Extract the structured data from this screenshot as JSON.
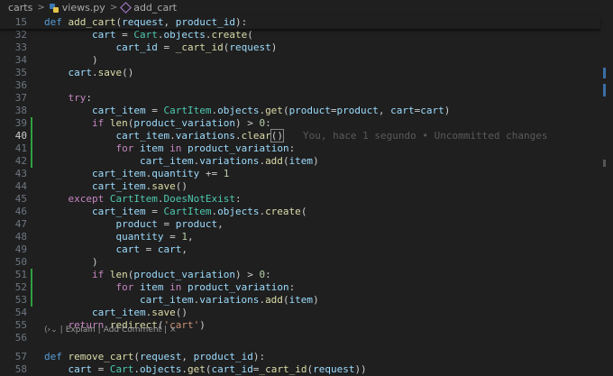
{
  "breadcrumb": {
    "folder": "carts",
    "file": "views.py",
    "symbol": "add_cart"
  },
  "colors": {
    "background": "#1f1f1f",
    "added_line_bar": "#2ea043",
    "scroll_marker": "#3a6ea5"
  },
  "editor": {
    "lines": [
      {
        "num": "15",
        "sticky": true,
        "segs": [
          [
            "def",
            "def "
          ],
          [
            "fn",
            "add_cart"
          ],
          [
            "plain",
            "("
          ],
          [
            "var",
            "request"
          ],
          [
            "plain",
            ", "
          ],
          [
            "var",
            "product_id"
          ],
          [
            "plain",
            "):"
          ]
        ]
      },
      {
        "num": "32",
        "sticky": false,
        "segs": [
          [
            "plain",
            "        "
          ],
          [
            "var",
            "cart"
          ],
          [
            "plain",
            " = "
          ],
          [
            "cls",
            "Cart"
          ],
          [
            "plain",
            "."
          ],
          [
            "var",
            "objects"
          ],
          [
            "plain",
            "."
          ],
          [
            "fn",
            "create"
          ],
          [
            "plain",
            "("
          ]
        ]
      },
      {
        "num": "33",
        "sticky": false,
        "segs": [
          [
            "plain",
            "            "
          ],
          [
            "var",
            "cart_id"
          ],
          [
            "plain",
            " = "
          ],
          [
            "fn",
            "_cart_id"
          ],
          [
            "plain",
            "("
          ],
          [
            "var",
            "request"
          ],
          [
            "plain",
            ")"
          ]
        ]
      },
      {
        "num": "34",
        "sticky": false,
        "segs": [
          [
            "plain",
            "        )"
          ]
        ]
      },
      {
        "num": "35",
        "sticky": false,
        "segs": [
          [
            "plain",
            "    "
          ],
          [
            "var",
            "cart"
          ],
          [
            "plain",
            "."
          ],
          [
            "fn",
            "save"
          ],
          [
            "plain",
            "()"
          ]
        ]
      },
      {
        "num": "36",
        "sticky": false,
        "segs": []
      },
      {
        "num": "37",
        "sticky": false,
        "segs": [
          [
            "plain",
            "    "
          ],
          [
            "kw",
            "try"
          ],
          [
            "plain",
            ":"
          ]
        ]
      },
      {
        "num": "38",
        "sticky": false,
        "segs": [
          [
            "plain",
            "        "
          ],
          [
            "var",
            "cart_item"
          ],
          [
            "plain",
            " = "
          ],
          [
            "cls",
            "CartItem"
          ],
          [
            "plain",
            "."
          ],
          [
            "var",
            "objects"
          ],
          [
            "plain",
            "."
          ],
          [
            "fn",
            "get"
          ],
          [
            "plain",
            "("
          ],
          [
            "var",
            "product"
          ],
          [
            "plain",
            "="
          ],
          [
            "var",
            "product"
          ],
          [
            "plain",
            ", "
          ],
          [
            "var",
            "cart"
          ],
          [
            "plain",
            "="
          ],
          [
            "var",
            "cart"
          ],
          [
            "plain",
            ")"
          ]
        ]
      },
      {
        "num": "39",
        "sticky": false,
        "mod": true,
        "segs": [
          [
            "plain",
            "        "
          ],
          [
            "kw",
            "if"
          ],
          [
            "plain",
            " "
          ],
          [
            "fn",
            "len"
          ],
          [
            "plain",
            "("
          ],
          [
            "var",
            "product_variation"
          ],
          [
            "plain",
            ") > "
          ],
          [
            "num",
            "0"
          ],
          [
            "plain",
            ":"
          ]
        ]
      },
      {
        "num": "40",
        "sticky": false,
        "mod": true,
        "current": true,
        "segs": [
          [
            "plain",
            "            "
          ],
          [
            "var",
            "cart_item"
          ],
          [
            "plain",
            "."
          ],
          [
            "var",
            "variations"
          ],
          [
            "plain",
            "."
          ],
          [
            "fn",
            "clear"
          ],
          [
            "hl",
            "()"
          ]
        ],
        "blame": "You, hace 1 segundo • Uncommitted changes"
      },
      {
        "num": "41",
        "sticky": false,
        "mod": true,
        "segs": [
          [
            "plain",
            "            "
          ],
          [
            "kw",
            "for"
          ],
          [
            "plain",
            " "
          ],
          [
            "var",
            "item"
          ],
          [
            "plain",
            " "
          ],
          [
            "kw",
            "in"
          ],
          [
            "plain",
            " "
          ],
          [
            "var",
            "product_variation"
          ],
          [
            "plain",
            ":"
          ]
        ]
      },
      {
        "num": "42",
        "sticky": false,
        "mod": true,
        "segs": [
          [
            "plain",
            "                "
          ],
          [
            "var",
            "cart_item"
          ],
          [
            "plain",
            "."
          ],
          [
            "var",
            "variations"
          ],
          [
            "plain",
            "."
          ],
          [
            "fn",
            "add"
          ],
          [
            "plain",
            "("
          ],
          [
            "var",
            "item"
          ],
          [
            "plain",
            ")"
          ]
        ]
      },
      {
        "num": "43",
        "sticky": false,
        "segs": [
          [
            "plain",
            "        "
          ],
          [
            "var",
            "cart_item"
          ],
          [
            "plain",
            "."
          ],
          [
            "var",
            "quantity"
          ],
          [
            "plain",
            " += "
          ],
          [
            "num",
            "1"
          ]
        ]
      },
      {
        "num": "44",
        "sticky": false,
        "segs": [
          [
            "plain",
            "        "
          ],
          [
            "var",
            "cart_item"
          ],
          [
            "plain",
            "."
          ],
          [
            "fn",
            "save"
          ],
          [
            "plain",
            "()"
          ]
        ]
      },
      {
        "num": "45",
        "sticky": false,
        "segs": [
          [
            "plain",
            "    "
          ],
          [
            "kw",
            "except"
          ],
          [
            "plain",
            " "
          ],
          [
            "cls",
            "CartItem"
          ],
          [
            "plain",
            "."
          ],
          [
            "cls",
            "DoesNotExist"
          ],
          [
            "plain",
            ":"
          ]
        ]
      },
      {
        "num": "46",
        "sticky": false,
        "segs": [
          [
            "plain",
            "        "
          ],
          [
            "var",
            "cart_item"
          ],
          [
            "plain",
            " = "
          ],
          [
            "cls",
            "CartItem"
          ],
          [
            "plain",
            "."
          ],
          [
            "var",
            "objects"
          ],
          [
            "plain",
            "."
          ],
          [
            "fn",
            "create"
          ],
          [
            "plain",
            "("
          ]
        ]
      },
      {
        "num": "47",
        "sticky": false,
        "segs": [
          [
            "plain",
            "            "
          ],
          [
            "var",
            "product"
          ],
          [
            "plain",
            " = "
          ],
          [
            "var",
            "product"
          ],
          [
            "plain",
            ","
          ]
        ]
      },
      {
        "num": "48",
        "sticky": false,
        "segs": [
          [
            "plain",
            "            "
          ],
          [
            "var",
            "quantity"
          ],
          [
            "plain",
            " = "
          ],
          [
            "num",
            "1"
          ],
          [
            "plain",
            ","
          ]
        ]
      },
      {
        "num": "49",
        "sticky": false,
        "segs": [
          [
            "plain",
            "            "
          ],
          [
            "var",
            "cart"
          ],
          [
            "plain",
            " = "
          ],
          [
            "var",
            "cart"
          ],
          [
            "plain",
            ","
          ]
        ]
      },
      {
        "num": "50",
        "sticky": false,
        "segs": [
          [
            "plain",
            "        )"
          ]
        ]
      },
      {
        "num": "51",
        "sticky": false,
        "mod": true,
        "segs": [
          [
            "plain",
            "        "
          ],
          [
            "kw",
            "if"
          ],
          [
            "plain",
            " "
          ],
          [
            "fn",
            "len"
          ],
          [
            "plain",
            "("
          ],
          [
            "var",
            "product_variation"
          ],
          [
            "plain",
            ") > "
          ],
          [
            "num",
            "0"
          ],
          [
            "plain",
            ":"
          ]
        ]
      },
      {
        "num": "52",
        "sticky": false,
        "mod": true,
        "segs": [
          [
            "plain",
            "            "
          ],
          [
            "kw",
            "for"
          ],
          [
            "plain",
            " "
          ],
          [
            "var",
            "item"
          ],
          [
            "plain",
            " "
          ],
          [
            "kw",
            "in"
          ],
          [
            "plain",
            " "
          ],
          [
            "var",
            "product_variation"
          ],
          [
            "plain",
            ":"
          ]
        ]
      },
      {
        "num": "53",
        "sticky": false,
        "mod": true,
        "segs": [
          [
            "plain",
            "                "
          ],
          [
            "var",
            "cart_item"
          ],
          [
            "plain",
            "."
          ],
          [
            "var",
            "variations"
          ],
          [
            "plain",
            "."
          ],
          [
            "fn",
            "add"
          ],
          [
            "plain",
            "("
          ],
          [
            "var",
            "item"
          ],
          [
            "plain",
            ")"
          ]
        ]
      },
      {
        "num": "54",
        "sticky": false,
        "segs": [
          [
            "plain",
            "        "
          ],
          [
            "var",
            "cart_item"
          ],
          [
            "plain",
            "."
          ],
          [
            "fn",
            "save"
          ],
          [
            "plain",
            "()"
          ]
        ]
      },
      {
        "num": "55",
        "sticky": false,
        "segs": [
          [
            "plain",
            "    "
          ],
          [
            "kw",
            "return"
          ],
          [
            "plain",
            " "
          ],
          [
            "fn",
            "redirect"
          ],
          [
            "plain",
            "("
          ],
          [
            "str",
            "'cart'"
          ],
          [
            "plain",
            ")"
          ]
        ]
      },
      {
        "num": "56",
        "sticky": false,
        "segs": []
      },
      {
        "num": "57",
        "sticky": false,
        "gap": true,
        "segs": [
          [
            "def",
            "def "
          ],
          [
            "fn",
            "remove_cart"
          ],
          [
            "plain",
            "("
          ],
          [
            "var",
            "request"
          ],
          [
            "plain",
            ", "
          ],
          [
            "var",
            "product_id"
          ],
          [
            "plain",
            "):"
          ]
        ]
      },
      {
        "num": "58",
        "sticky": false,
        "segs": [
          [
            "plain",
            "    "
          ],
          [
            "var",
            "cart"
          ],
          [
            "plain",
            " = "
          ],
          [
            "cls",
            "Cart"
          ],
          [
            "plain",
            "."
          ],
          [
            "var",
            "objects"
          ],
          [
            "plain",
            "."
          ],
          [
            "fn",
            "get"
          ],
          [
            "plain",
            "("
          ],
          [
            "var",
            "cart_id"
          ],
          [
            "plain",
            "="
          ],
          [
            "fn",
            "_cart_id"
          ],
          [
            "plain",
            "("
          ],
          [
            "var",
            "request"
          ],
          [
            "plain",
            "))"
          ]
        ]
      }
    ],
    "codelens": {
      "icon": "sparkle-icon",
      "explain": "Explain",
      "divider": "|",
      "add_comment": "Add Comment",
      "close": "×"
    }
  }
}
